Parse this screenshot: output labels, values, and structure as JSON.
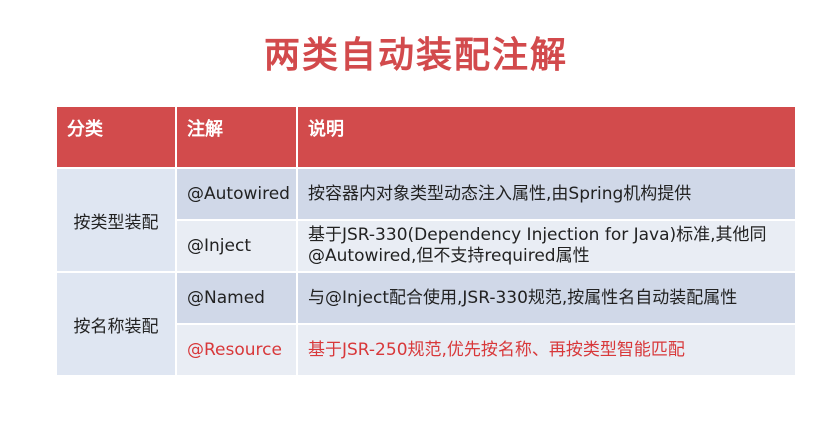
{
  "title": "两类自动装配注解",
  "table": {
    "headers": [
      "分类",
      "注解",
      "说明"
    ],
    "groups": [
      {
        "category": "按类型装配",
        "rows": [
          {
            "annotation": "@Autowired",
            "description": "按容器内对象类型动态注入属性,由Spring机构提供"
          },
          {
            "annotation": "@Inject",
            "description": "基于JSR-330(Dependency Injection for Java)标准,其他同@Autowired,但不支持required属性"
          }
        ]
      },
      {
        "category": "按名称装配",
        "rows": [
          {
            "annotation": "@Named",
            "description": "与@Inject配合使用,JSR-330规范,按属性名自动装配属性"
          },
          {
            "annotation": "@Resource",
            "description": "基于JSR-250规范,优先按名称、再按类型智能匹配",
            "highlight_color": "#d8383a"
          }
        ]
      }
    ]
  }
}
